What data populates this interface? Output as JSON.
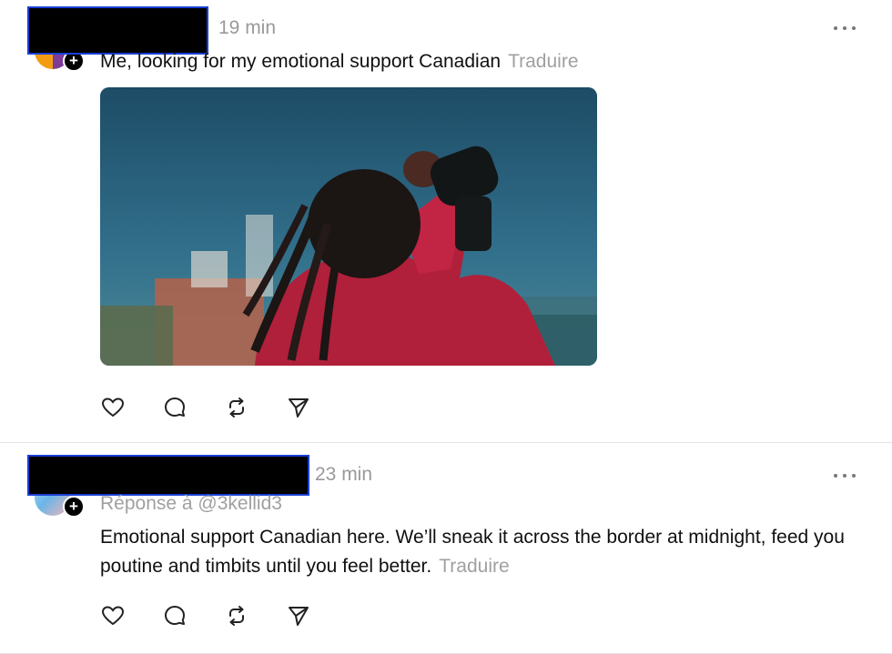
{
  "posts": [
    {
      "time": "19 min",
      "text": "Me, looking for my emotional support Canadian",
      "translate": "Traduire",
      "media_alt": "person-with-binoculars"
    },
    {
      "time": "23 min",
      "reply_to": "Réponse à @3kellid3",
      "text": "Emotional support Canadian here. We’ll sneak it across the border at midnight, feed you poutine and timbits until you feel better.",
      "translate": "Traduire"
    }
  ],
  "icons": {
    "like": "heart-icon",
    "reply": "comment-icon",
    "repost": "repost-icon",
    "share": "send-icon",
    "more": "more-icon",
    "follow": "plus-icon"
  },
  "colors": {
    "muted": "#999999",
    "text": "#101010",
    "redaction": "#000000",
    "redaction_border": "#1a3fd6"
  }
}
